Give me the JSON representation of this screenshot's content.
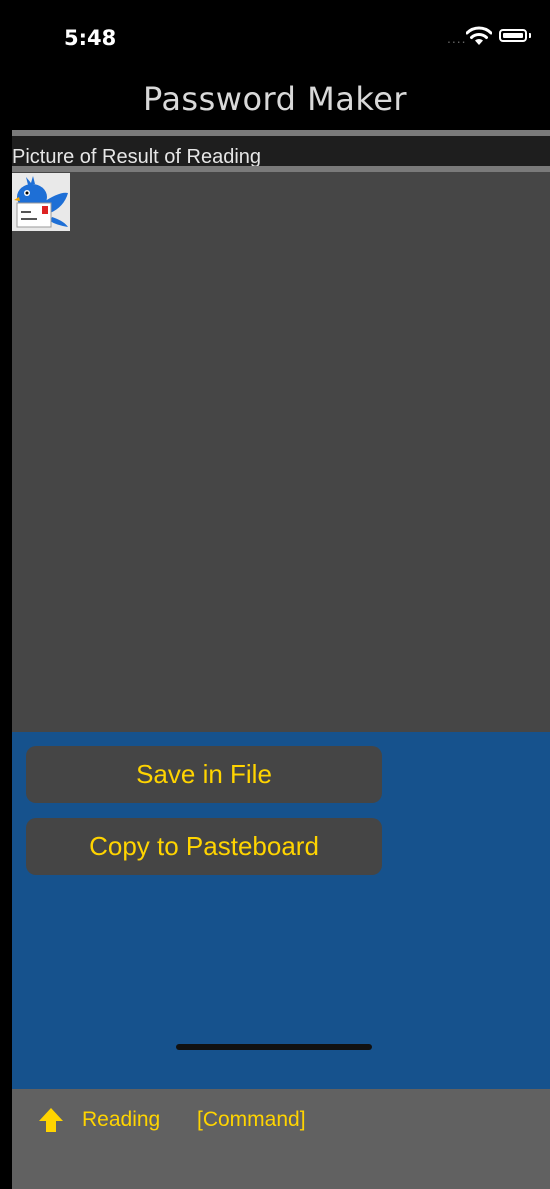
{
  "status": {
    "time": "5:48",
    "signal": "....",
    "icons": [
      "wifi-icon",
      "battery-icon"
    ]
  },
  "nav": {
    "title": "Password Maker"
  },
  "section": {
    "label": "Picture of Result of Reading"
  },
  "result": {
    "thumbnail_icon": "bird-mail-icon"
  },
  "actions": {
    "save_label": "Save in File",
    "copy_label": "Copy to Pasteboard"
  },
  "toolbar": {
    "home_icon": "home-arrow-icon",
    "reading_label": "Reading",
    "command_label": "[Command]"
  },
  "colors": {
    "accent": "#ffd400",
    "panel": "#16528d",
    "content_bg": "#464646",
    "toolbar_bg": "#616161"
  }
}
